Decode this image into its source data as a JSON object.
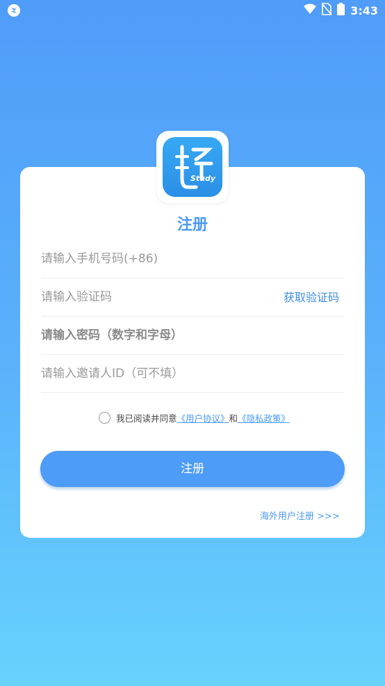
{
  "status_bar": {
    "time": "3:43",
    "icons": [
      "app-icon",
      "wifi-icon",
      "no-sim-icon",
      "battery-icon"
    ]
  },
  "logo": {
    "label": "Study"
  },
  "title": "注册",
  "fields": {
    "phone_placeholder": "请输入手机号码(+86)",
    "code_placeholder": "请输入验证码",
    "get_code_label": "获取验证码",
    "password_placeholder": "请输入密码（数字和字母）",
    "invite_placeholder": "请输入邀请人ID（可不填）"
  },
  "agreement": {
    "prefix": "我已阅读并同意",
    "user_agreement": "《用户协议》",
    "and": "和",
    "privacy_policy": "《隐私政策》"
  },
  "register_button": "注册",
  "overseas_link": "海外用户注册 >>>",
  "colors": {
    "accent": "#4a9af5",
    "button": "#4d9cf7"
  }
}
